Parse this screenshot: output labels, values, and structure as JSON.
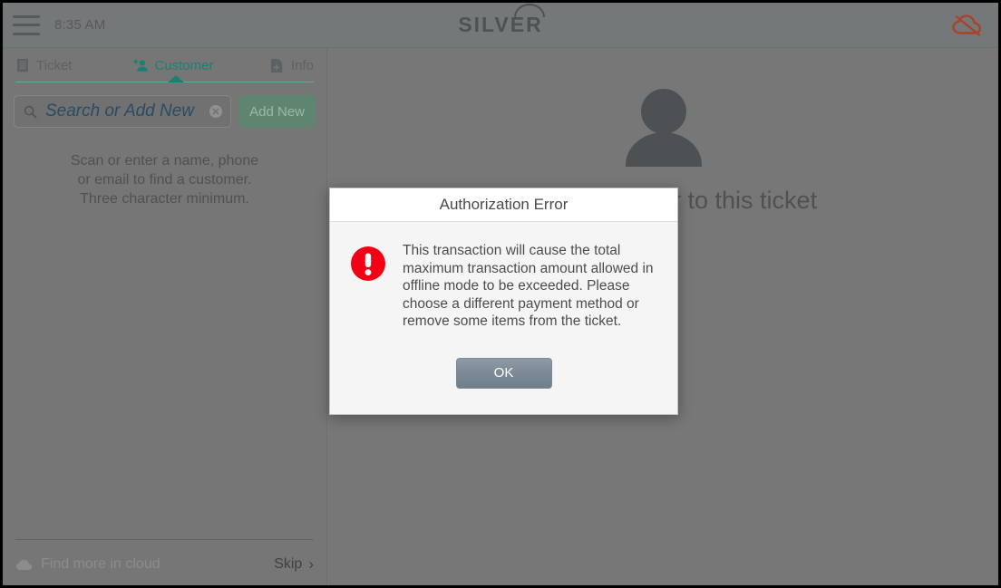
{
  "topbar": {
    "menu_icon": "hamburger-icon",
    "time": "8:35 AM",
    "logo_text": "SILVER",
    "status_icon": "cloud-offline-icon",
    "status_icon_color": "#a8432a"
  },
  "sidebar": {
    "tabs": [
      {
        "label": "Ticket",
        "icon": "receipt-icon",
        "active": false
      },
      {
        "label": "Customer",
        "icon": "add-person-icon",
        "active": true
      },
      {
        "label": "Info",
        "icon": "add-document-icon",
        "active": false
      }
    ],
    "active_tab_color": "#1c8071",
    "search": {
      "icon": "search-icon",
      "value": "",
      "placeholder": "Search or Add New",
      "clear_icon": "clear-circle-icon"
    },
    "add_new_label": "Add New",
    "hint_lines": [
      "Scan or enter a name, phone",
      "or email to find a customer.",
      "Three character minimum."
    ],
    "footer": {
      "cloud_icon": "cloud-icon",
      "cloud_label": "Find more in cloud",
      "skip_label": "Skip",
      "skip_chevron": "›"
    }
  },
  "main": {
    "avatar_icon": "person-avatar-icon",
    "title": "Add a customer to this ticket"
  },
  "dialog": {
    "title": "Authorization Error",
    "icon": "error-exclamation-icon",
    "icon_color": "#f20015",
    "message": "This transaction will cause the total maximum transaction amount allowed in offline mode to be exceeded. Please choose a different payment method or remove some items from the ticket.",
    "ok_label": "OK"
  }
}
